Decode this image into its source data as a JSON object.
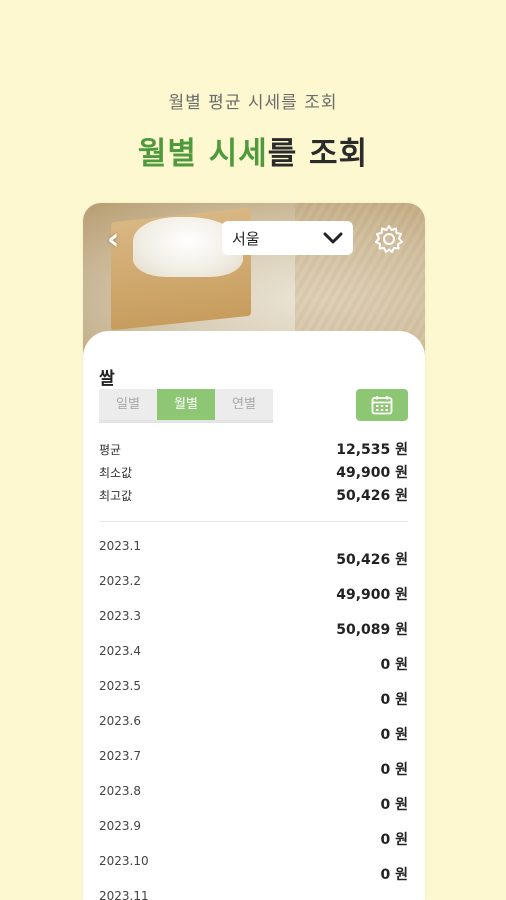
{
  "promo": {
    "subtitle": "월별 평균 시세를 조회",
    "headline_green": "월별 시세",
    "headline_rest": "를 조회"
  },
  "header": {
    "back_icon": "chevron-left-icon",
    "region_value": "서울",
    "settings_icon": "gear-icon"
  },
  "item": {
    "title": "쌀"
  },
  "tabs": [
    {
      "label": "일별",
      "active": false
    },
    {
      "label": "월별",
      "active": true
    },
    {
      "label": "연별",
      "active": false
    }
  ],
  "calendar_icon": "calendar-icon",
  "summary": {
    "average_label": "평균",
    "average_value": "12,535 원",
    "min_label": "최소값",
    "min_value": "49,900 원",
    "max_label": "최고값",
    "max_value": "50,426 원"
  },
  "monthly": [
    {
      "date": "2023.1",
      "price": "50,426 원"
    },
    {
      "date": "2023.2",
      "price": "49,900 원"
    },
    {
      "date": "2023.3",
      "price": "50,089 원"
    },
    {
      "date": "2023.4",
      "price": "0 원"
    },
    {
      "date": "2023.5",
      "price": "0 원"
    },
    {
      "date": "2023.6",
      "price": "0 원"
    },
    {
      "date": "2023.7",
      "price": "0 원"
    },
    {
      "date": "2023.8",
      "price": "0 원"
    },
    {
      "date": "2023.9",
      "price": "0 원"
    },
    {
      "date": "2023.10",
      "price": "0 원"
    },
    {
      "date": "2023.11",
      "price": ""
    }
  ],
  "colors": {
    "background": "#fdf8cf",
    "accent_green": "#8dc774",
    "headline_green": "#4e9a3d"
  }
}
